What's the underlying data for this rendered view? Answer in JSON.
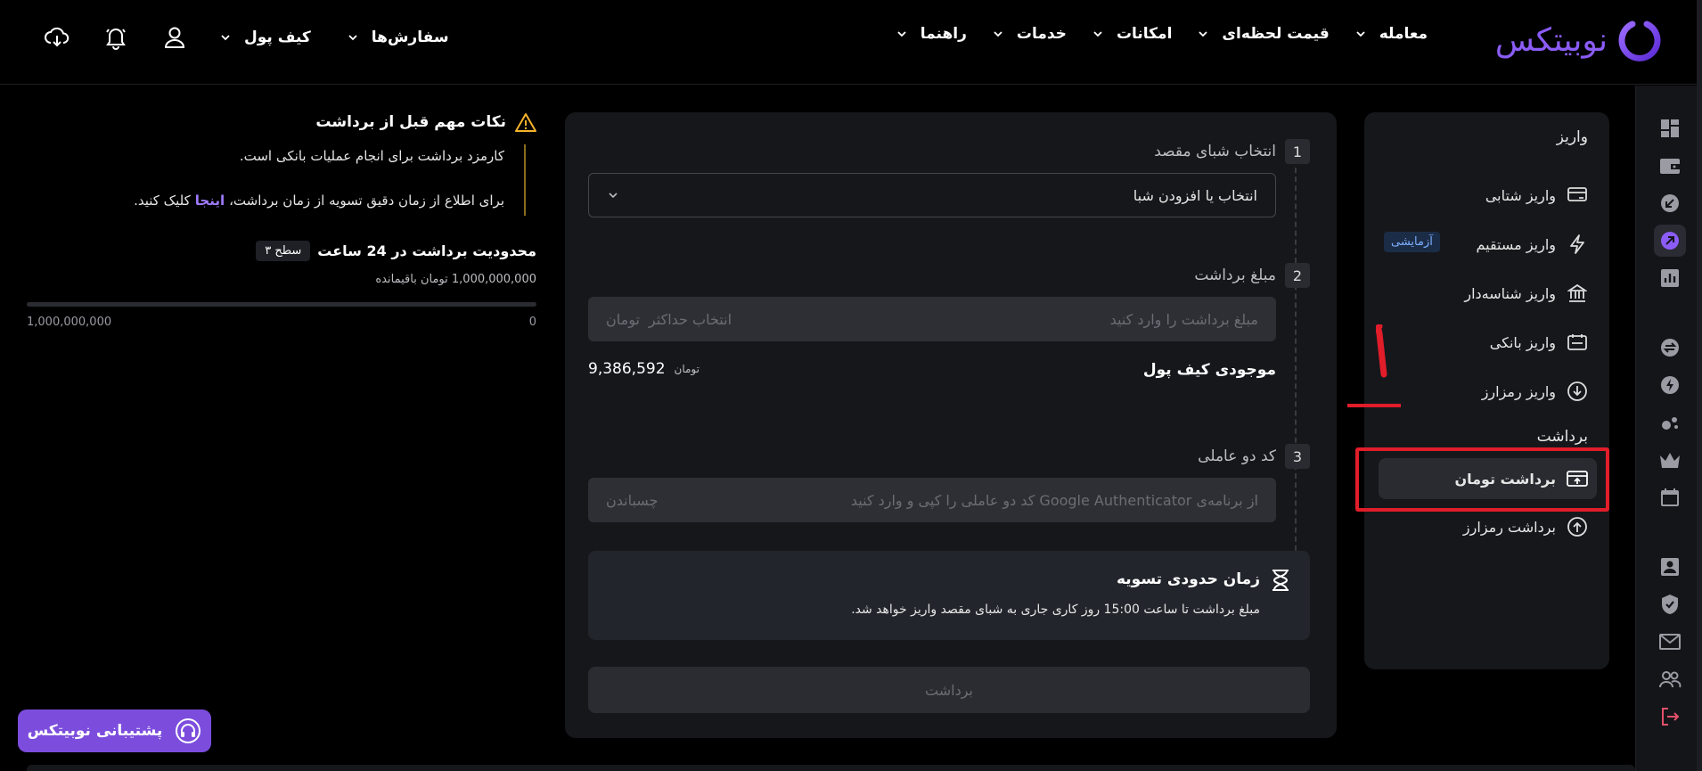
{
  "brand": {
    "name": "نوبیتکس",
    "accent": "#8b5cf6"
  },
  "nav": {
    "items": [
      {
        "label": "معامله"
      },
      {
        "label": "قیمت لحظه‌ای"
      },
      {
        "label": "امکانات"
      },
      {
        "label": "خدمات"
      },
      {
        "label": "راهنما"
      }
    ],
    "orders_label": "سفارش‌ها",
    "wallet_label": "کیف پول"
  },
  "sidebar": {
    "deposit_title": "واریز",
    "deposit_items": [
      {
        "label": "واریز شتابی",
        "icon": "card-transfer-icon"
      },
      {
        "label": "واریز مستقیم",
        "icon": "lightning-icon",
        "badge": "آزمایشی"
      },
      {
        "label": "واریز شناسه‌دار",
        "icon": "bank-icon"
      },
      {
        "label": "واریز بانکی",
        "icon": "bank-card-icon"
      },
      {
        "label": "واریز رمزارز",
        "icon": "download-circle-icon"
      }
    ],
    "withdraw_title": "برداشت",
    "withdraw_items": [
      {
        "label": "برداشت تومان",
        "icon": "card-upload-icon",
        "active": true
      },
      {
        "label": "برداشت رمزارز",
        "icon": "upload-circle-icon"
      }
    ]
  },
  "annotation": {
    "number": "۱",
    "color": "#e11d2a"
  },
  "form": {
    "step1": {
      "num": "1",
      "label": "انتخاب شبای مقصد",
      "select_value": "انتخاب یا افزودن شبا"
    },
    "step2": {
      "num": "2",
      "label": "مبلغ برداشت",
      "placeholder": "مبلغ برداشت را وارد کنید",
      "max_link": "انتخاب حداکثر",
      "unit": "تومان"
    },
    "balance": {
      "label": "موجودی کیف پول",
      "value": "9,386,592",
      "unit": "تومان"
    },
    "step3": {
      "num": "3",
      "label": "کد دو عاملی",
      "placeholder": "از برنامه‌ی Google Authenticator کد دو عاملی را کپی و وارد کنید",
      "paste": "چسباندن"
    },
    "settlement": {
      "title": "زمان حدودی تسویه",
      "text": "مبلغ برداشت تا ساعت 15:00 روز کاری جاری به شبای مقصد واریز خواهد شد."
    },
    "submit_label": "برداشت"
  },
  "notes": {
    "title": "نکات مهم قبل از برداشت",
    "line1": "کارمزد برداشت برای انجام عملیات بانکی است.",
    "line2_prefix": "برای اطلاع از زمان دقیق تسویه از زمان برداشت،",
    "line2_link": "اینجا",
    "line2_suffix": "کلیک کنید."
  },
  "limit": {
    "title": "محدودیت برداشت در 24 ساعت",
    "level": "سطح ۳",
    "remaining": "1,000,000,000 تومان باقیمانده",
    "min": "0",
    "max": "1,000,000,000",
    "used_fraction": 0
  },
  "support": {
    "label": "پشتیبانی نوبیتکس"
  }
}
